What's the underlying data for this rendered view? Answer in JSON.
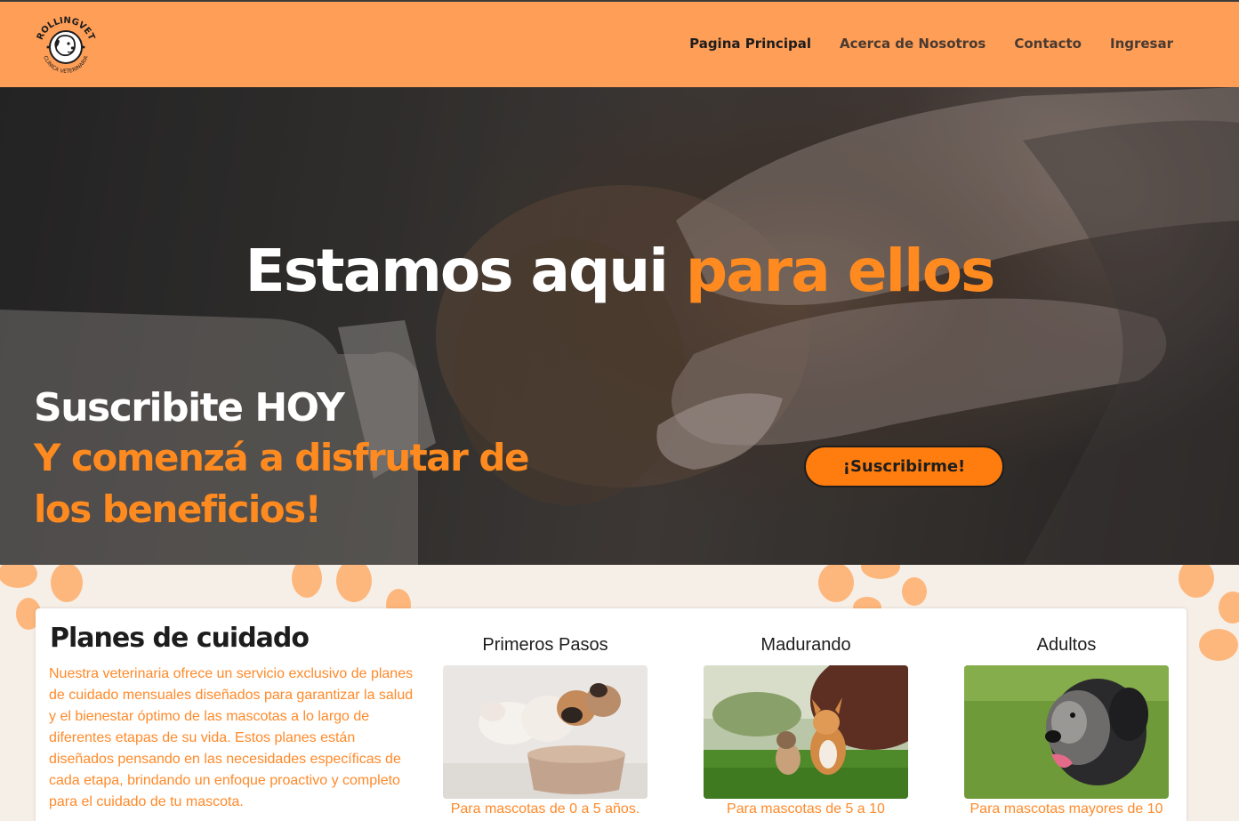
{
  "brand": {
    "logo_text_top": "ROLLINGVET",
    "logo_text_bottom": "CLINICA VETERINARIA"
  },
  "nav": {
    "items": [
      {
        "label": "Pagina Principal",
        "active": true
      },
      {
        "label": "Acerca de Nosotros",
        "active": false
      },
      {
        "label": "Contacto",
        "active": false
      },
      {
        "label": "Ingresar",
        "active": false
      }
    ]
  },
  "hero": {
    "title_white": "Estamos aqui ",
    "title_accent": "para ellos",
    "subscribe_line1": "Suscribite HOY",
    "subscribe_line2": "Y comenzá a disfrutar de",
    "subscribe_line3": "los beneficios!",
    "cta_label": "¡Suscribirme!"
  },
  "plans": {
    "title": "Planes de cuidado",
    "description": "Nuestra veterinaria ofrece un servicio exclusivo de planes de cuidado mensuales diseñados para garantizar la salud y el bienestar óptimo de las mascotas a lo largo de diferentes etapas de su vida. Estos planes están diseñados pensando en las necesidades específicas de cada etapa, brindando un enfoque proactivo y completo para el cuidado de tu mascota.",
    "items": [
      {
        "name": "Primeros Pasos",
        "caption": "Para mascotas de 0 a 5 años."
      },
      {
        "name": "Madurando",
        "caption": "Para mascotas de 5 a 10"
      },
      {
        "name": "Adultos",
        "caption": "Para mascotas mayores de 10"
      }
    ]
  },
  "colors": {
    "navbar": "#ff9e57",
    "accent": "#ff8a1f",
    "cta": "#ff7d0f",
    "paws": "#ffae6b",
    "band": "#f6efe7"
  }
}
